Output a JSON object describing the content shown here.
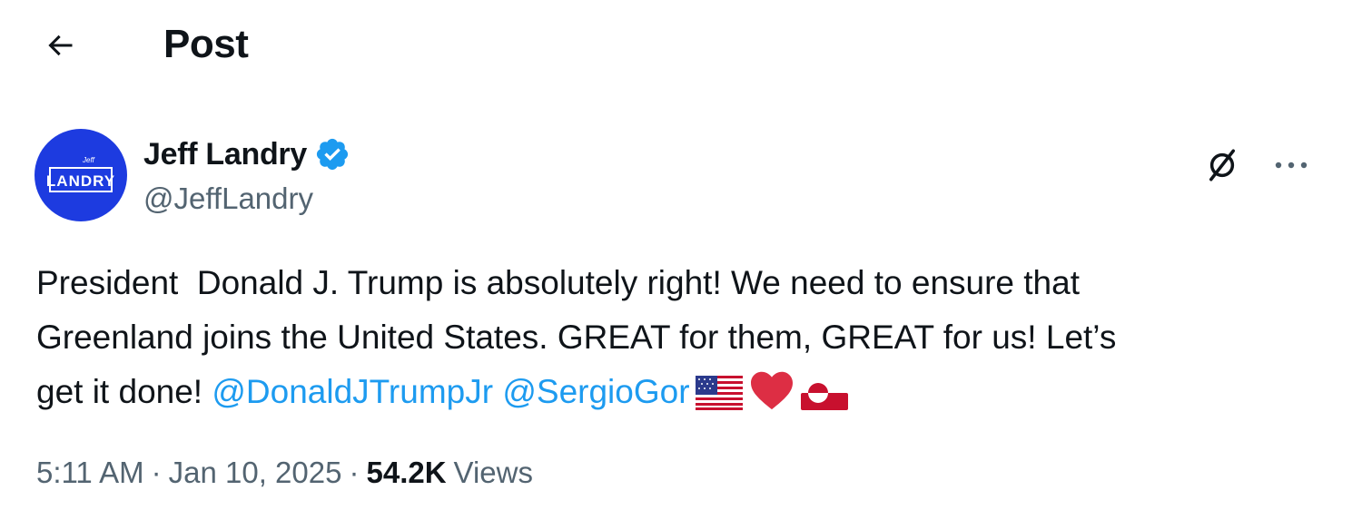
{
  "header": {
    "title": "Post",
    "back_icon": "arrow-left-icon"
  },
  "author": {
    "display_name": "Jeff Landry",
    "handle": "@JeffLandry",
    "verified": true,
    "verified_color": "#1d9bf0",
    "avatar_bg": "#1d3be0",
    "avatar_text": "LANDRY",
    "avatar_subtext": "Jeff"
  },
  "actions": {
    "grok_icon": "grok-icon",
    "more_icon": "more-dots-icon"
  },
  "tweet": {
    "text_line1": "President  Donald J. Trump is absolutely right! We need to ensure that",
    "text_line2": "Greenland joins the United States. GREAT for them, GREAT for us! Let’s",
    "text_line3_prefix": "get it done! ",
    "mentions": [
      "@DonaldJTrumpJr",
      "@SergioGor"
    ],
    "emojis": [
      "us-flag-emoji",
      "red-heart-emoji",
      "greenland-flag-emoji"
    ],
    "mention_color": "#1d9bf0"
  },
  "meta": {
    "time": "5:11 AM",
    "separator": "·",
    "date": "Jan 10, 2025",
    "views_count": "54.2K",
    "views_label": "Views"
  }
}
